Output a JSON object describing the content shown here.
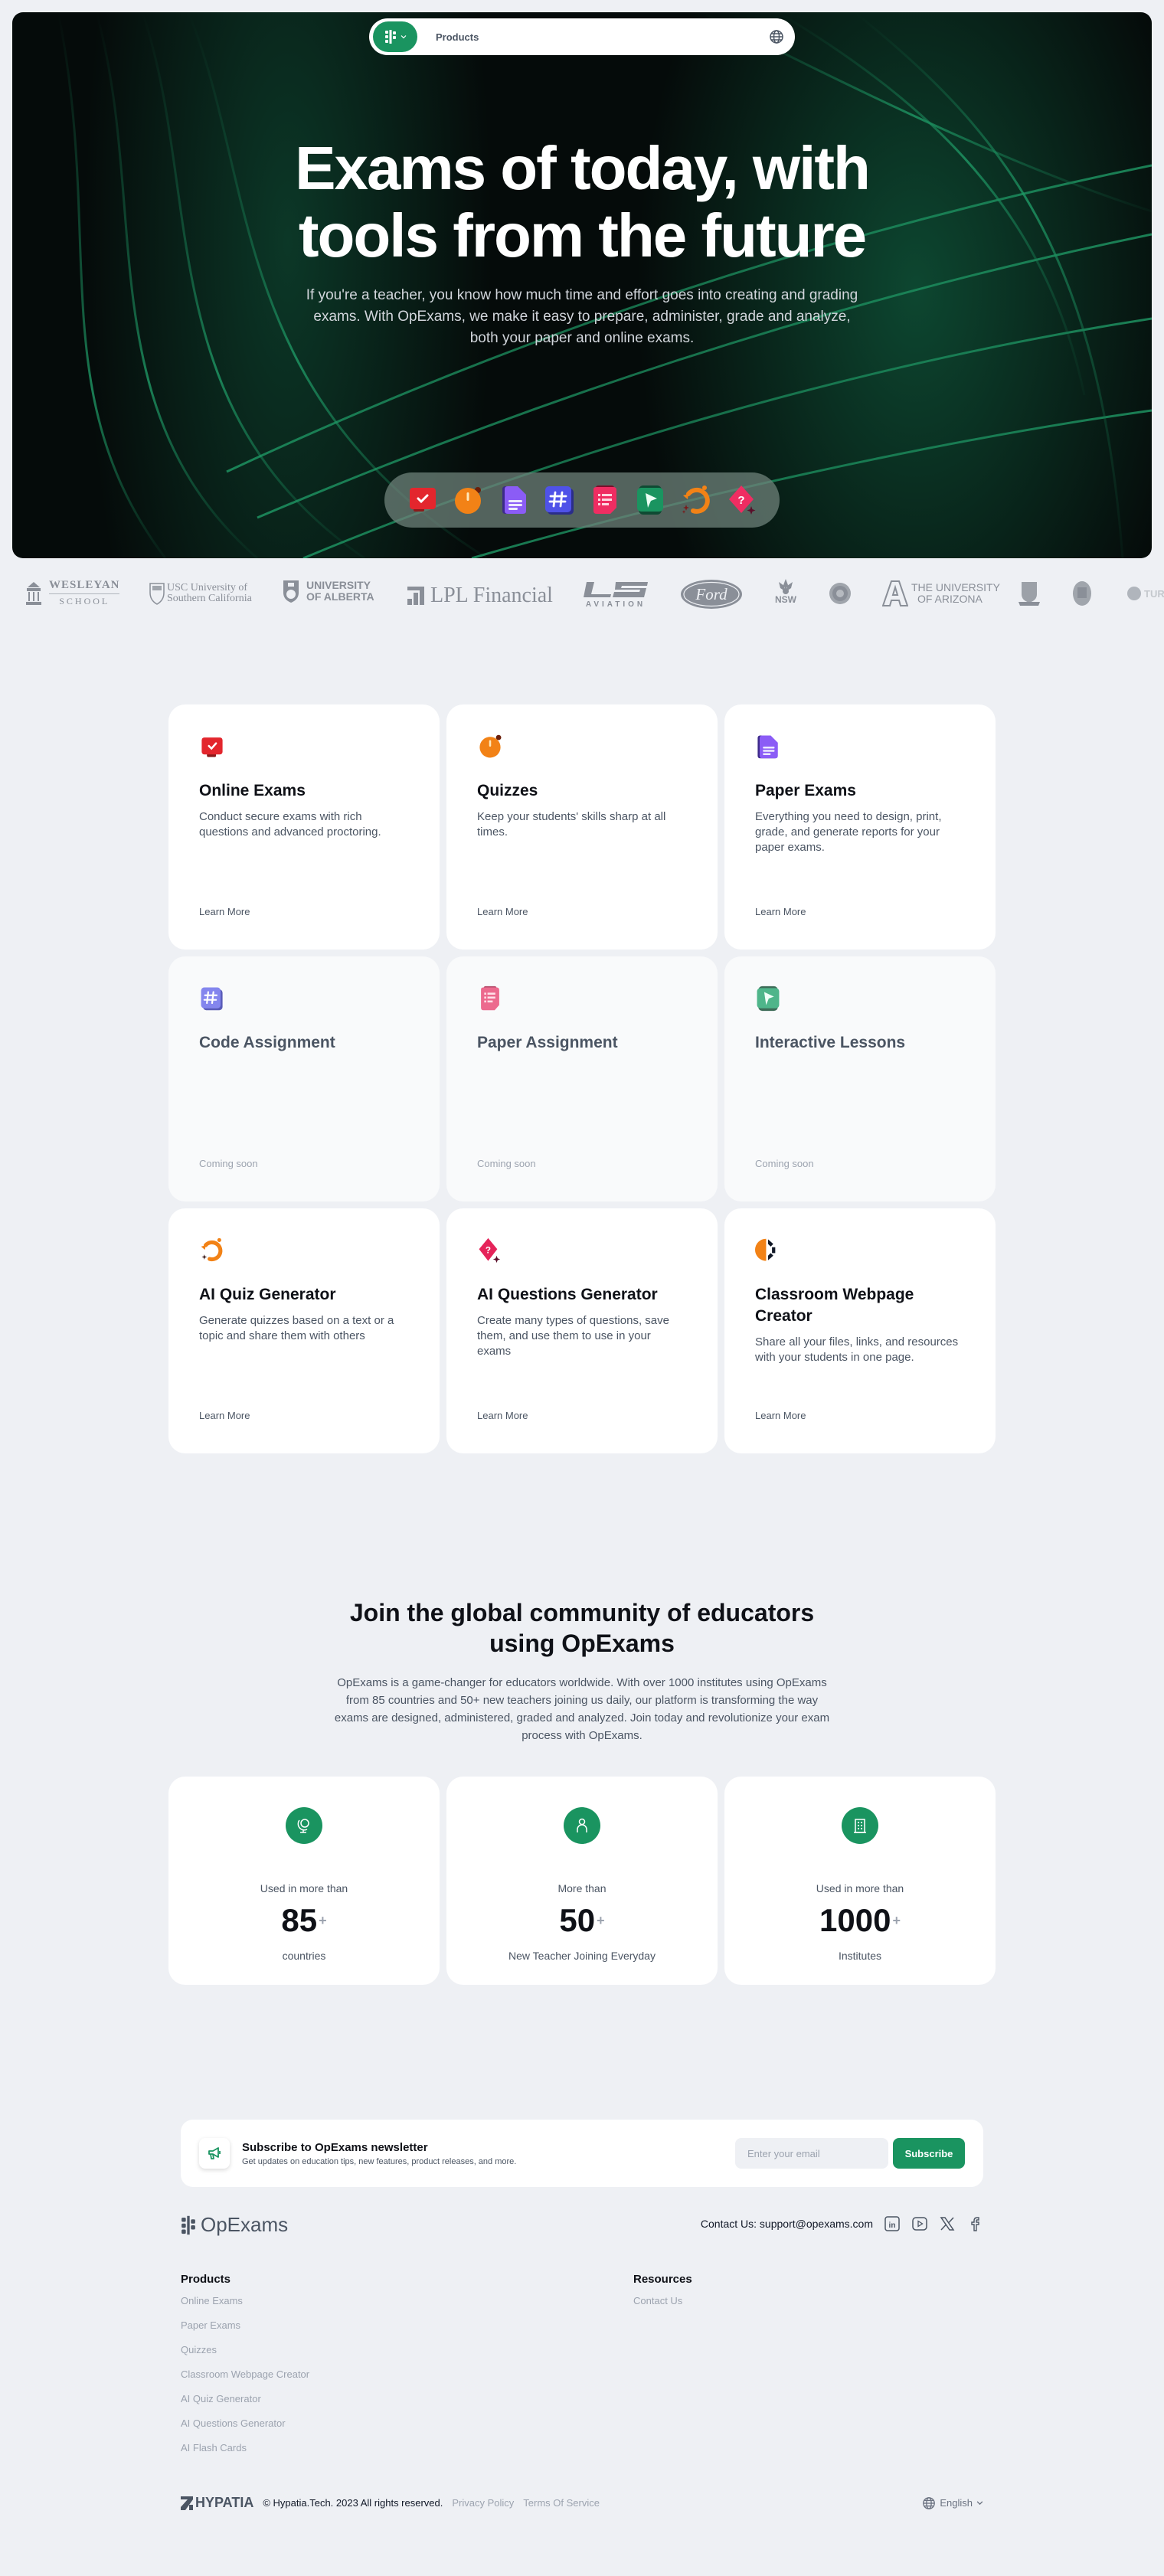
{
  "nav": {
    "products_label": "Products",
    "brand_color": "#1a9460"
  },
  "hero": {
    "title_line1": "Exams of today, with",
    "title_line2": "tools from the future",
    "subtitle": "If you're a teacher, you know how much time and effort goes into creating and grading exams. With OpExams, we make it easy to prepare, administer, grade and analyze, both your paper and online exams.",
    "dock_icons": [
      "online-exams-icon",
      "quizzes-icon",
      "paper-exams-icon",
      "code-assignment-icon",
      "paper-assignment-icon",
      "interactive-lessons-icon",
      "ai-quiz-generator-icon",
      "ai-questions-generator-icon"
    ]
  },
  "logos": [
    {
      "name": "WESLEYAN",
      "sub": "SCHOOL"
    },
    {
      "name": "USC University of",
      "sub": "Southern California"
    },
    {
      "name": "UNIVERSITY",
      "sub": "OF ALBERTA"
    },
    {
      "name": "LPL Financial",
      "sub": ""
    },
    {
      "name": "L2",
      "sub": "AVIATION"
    },
    {
      "name": "Ford",
      "sub": ""
    },
    {
      "name": "NSW",
      "sub": ""
    },
    {
      "name": "THE UNIVERSITY",
      "sub": "OF ARIZONA"
    },
    {
      "name": "TUR",
      "sub": ""
    }
  ],
  "features": [
    {
      "title": "Online Exams",
      "desc": "Conduct secure exams with rich questions and advanced proctoring.",
      "link": "Learn More",
      "icon": "online-exams-icon"
    },
    {
      "title": "Quizzes",
      "desc": "Keep your students' skills sharp at all times.",
      "link": "Learn More",
      "icon": "quizzes-icon"
    },
    {
      "title": "Paper Exams",
      "desc": "Everything you need to design, print, grade, and generate reports for your paper exams.",
      "link": "Learn More",
      "icon": "paper-exams-icon"
    },
    {
      "title": "Code Assignment",
      "desc": "",
      "link": "Coming soon",
      "icon": "code-assignment-icon"
    },
    {
      "title": "Paper Assignment",
      "desc": "",
      "link": "Coming soon",
      "icon": "paper-assignment-icon"
    },
    {
      "title": "Interactive Lessons",
      "desc": "",
      "link": "Coming soon",
      "icon": "interactive-lessons-icon"
    },
    {
      "title": "AI Quiz Generator",
      "desc": "Generate quizzes based on a text or a topic and share them with others",
      "link": "Learn More",
      "icon": "ai-quiz-generator-icon"
    },
    {
      "title": "AI Questions Generator",
      "desc": "Create many types of questions, save them, and use them to use in your exams",
      "link": "Learn More",
      "icon": "ai-questions-generator-icon"
    },
    {
      "title": "Classroom Webpage Creator",
      "desc": "Share all your files, links, and resources with your students in one page.",
      "link": "Learn More",
      "icon": "classroom-webpage-icon"
    }
  ],
  "community": {
    "title": "Join the global community of educators using OpExams",
    "desc": "OpExams is a game-changer for educators worldwide. With over 1000 institutes using OpExams from 85 countries and 50+ new teachers joining us daily, our platform is transforming the way exams are designed, administered, graded and analyzed. Join today and revolutionize your exam process with OpExams.",
    "stats": [
      {
        "pre": "Used in more than",
        "value": "85",
        "plus": "+",
        "post": "countries",
        "icon": "globe-stand-icon"
      },
      {
        "pre": "More than",
        "value": "50",
        "plus": "+",
        "post": "New Teacher Joining Everyday",
        "icon": "user-icon"
      },
      {
        "pre": "Used in more than",
        "value": "1000",
        "plus": "+",
        "post": "Institutes",
        "icon": "building-icon"
      }
    ]
  },
  "newsletter": {
    "title": "Subscribe to OpExams newsletter",
    "subtitle": "Get updates on education tips, new features, product releases, and more.",
    "email_placeholder": "Enter your email",
    "button_label": "Subscribe"
  },
  "footer": {
    "brand": "OpExams",
    "contact": "Contact Us: support@opexams.com",
    "products_title": "Products",
    "products": [
      "Online Exams",
      "Paper Exams",
      "Quizzes",
      "Classroom Webpage Creator",
      "AI Quiz Generator",
      "AI Questions Generator",
      "AI Flash Cards"
    ],
    "resources_title": "Resources",
    "resources": [
      "Contact Us"
    ],
    "company": "HYPATIA",
    "copyright": "© Hypatia.Tech. 2023 All rights reserved.",
    "privacy": "Privacy Policy",
    "terms": "Terms Of Service",
    "language": "English"
  }
}
